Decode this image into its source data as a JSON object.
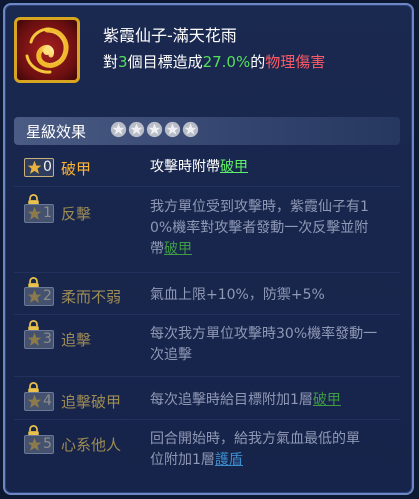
{
  "skill": {
    "icon": "swirl-emblem-icon",
    "name": "紫霞仙子-滿天花雨",
    "desc_prefix": "對",
    "target_count": "3",
    "desc_middle": "個目標造成",
    "percent": "27.0%",
    "desc_of": "的",
    "damage_type": "物理傷害"
  },
  "star_section": {
    "title": "星級效果",
    "stars_filled": 5
  },
  "effects": [
    {
      "star": "0",
      "name": "破甲",
      "locked": false,
      "lines": [
        "攻擊時附帶",
        "破甲"
      ]
    },
    {
      "star": "1",
      "name": "反擊",
      "locked": true,
      "line1": "我方單位受到攻擊時，紫霞仙子有1",
      "line2_prefix": "0%機率對攻擊者發動一次反擊並附",
      "line3_prefix": "帶",
      "line3_link": "破甲"
    },
    {
      "star": "2",
      "name": "柔而不弱",
      "locked": true,
      "text": "氣血上限+10%，防禦+5%"
    },
    {
      "star": "3",
      "name": "追擊",
      "locked": true,
      "line1": "每次我方單位攻擊時30%機率發動一",
      "line2": "次追擊"
    },
    {
      "star": "4",
      "name": "追擊破甲",
      "locked": true,
      "prefix": "每次追擊時給目標附加1層",
      "link": "破甲"
    },
    {
      "star": "5",
      "name": "心系他人",
      "locked": true,
      "line1": "回合開始時，給我方氣血最低的單",
      "line2_prefix": "位附加1層",
      "line2_link": "護盾"
    }
  ]
}
